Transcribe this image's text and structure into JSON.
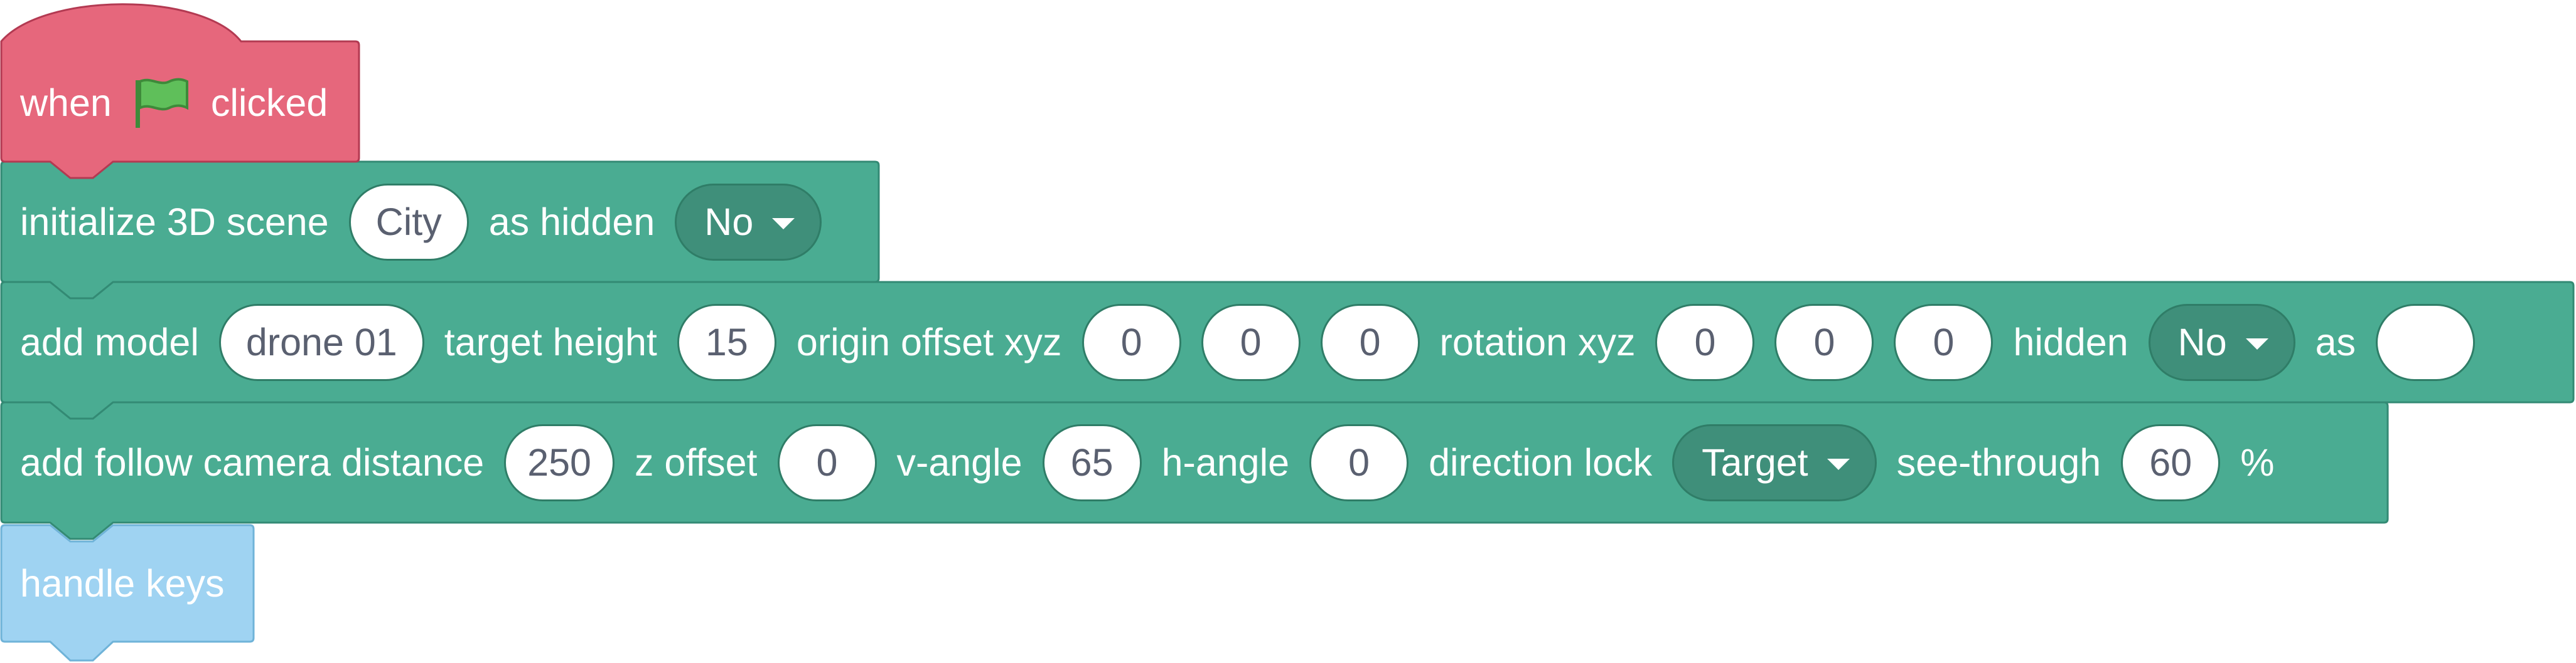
{
  "colors": {
    "event": "#e6677c",
    "motion": "#4aac92",
    "custom": "#9fd3f2",
    "dropdown": "#3f8f7a"
  },
  "hat": {
    "when_label": "when",
    "flag_icon": "green-flag-icon",
    "clicked_label": "clicked"
  },
  "init_scene": {
    "label": "initialize 3D scene",
    "scene_value": "City",
    "hidden_label": "as hidden",
    "hidden_value": "No"
  },
  "add_model": {
    "label": "add model",
    "model_value": "drone 01",
    "target_height_label": "target height",
    "target_height_value": "15",
    "origin_label": "origin offset xyz",
    "origin_x": "0",
    "origin_y": "0",
    "origin_z": "0",
    "rotation_label": "rotation xyz",
    "rotation_x": "0",
    "rotation_y": "0",
    "rotation_z": "0",
    "hidden_label": "hidden",
    "hidden_value": "No",
    "as_label": "as",
    "as_value": ""
  },
  "follow_camera": {
    "label": "add follow camera distance",
    "distance_value": "250",
    "z_offset_label": "z offset",
    "z_offset_value": "0",
    "v_angle_label": "v-angle",
    "v_angle_value": "65",
    "h_angle_label": "h-angle",
    "h_angle_value": "0",
    "direction_lock_label": "direction lock",
    "direction_lock_value": "Target",
    "see_through_label": "see-through",
    "see_through_value": "60",
    "percent_label": "%"
  },
  "custom_block": {
    "label": "handle keys"
  }
}
